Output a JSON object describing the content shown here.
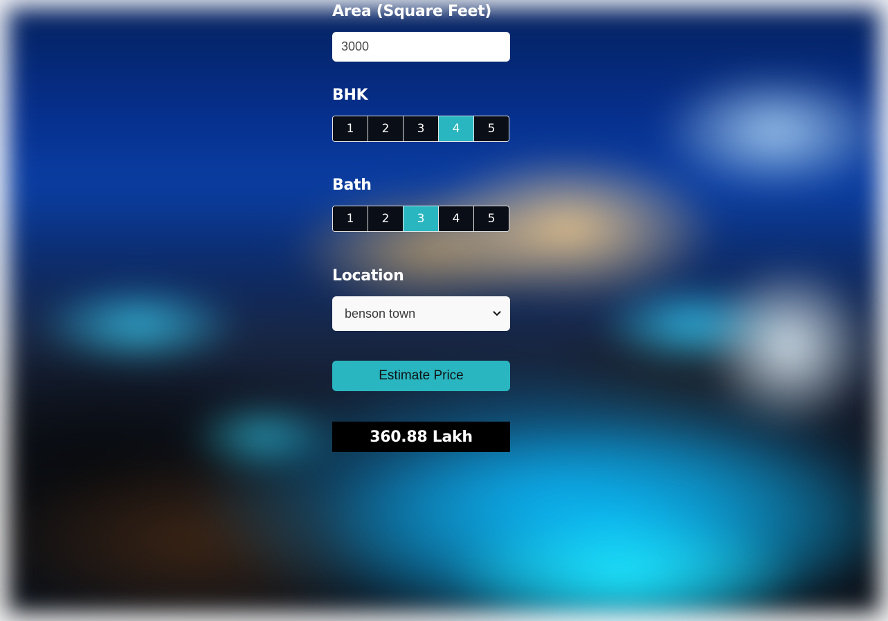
{
  "form": {
    "area": {
      "label": "Area (Square Feet)",
      "value": "3000"
    },
    "bhk": {
      "label": "BHK",
      "options": [
        "1",
        "2",
        "3",
        "4",
        "5"
      ],
      "selected": "4"
    },
    "bath": {
      "label": "Bath",
      "options": [
        "1",
        "2",
        "3",
        "4",
        "5"
      ],
      "selected": "3"
    },
    "location": {
      "label": "Location",
      "selected": "benson town"
    },
    "estimate_button": "Estimate Price",
    "result": "360.88 Lakh"
  },
  "colors": {
    "accent": "#29b6c1",
    "result_bg": "#000000",
    "segment_bg": "#0a0e17"
  },
  "icons": {
    "select_arrow": "chevron-down-icon"
  }
}
